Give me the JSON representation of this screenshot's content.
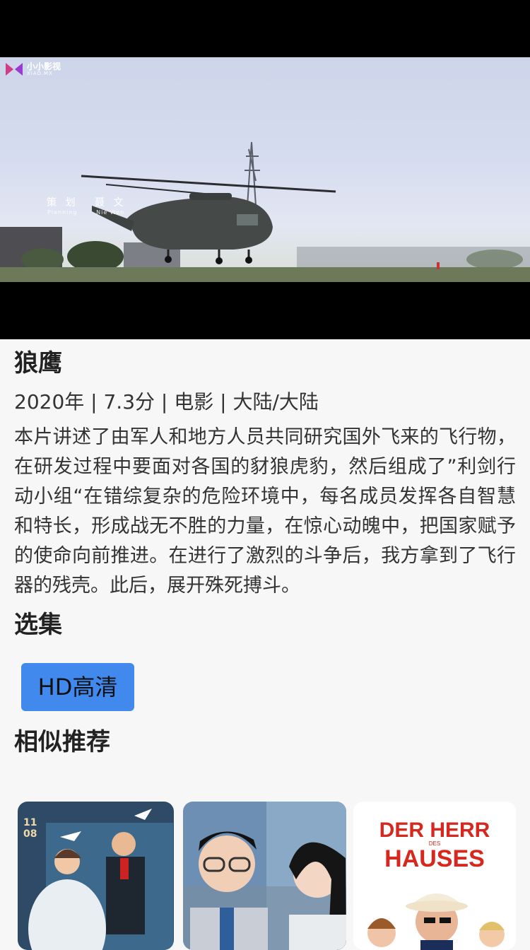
{
  "player": {
    "watermark_title": "小小影视",
    "watermark_sub": "XIAO.MX",
    "credit_1_cn": "策 划",
    "credit_1_en": "Planning",
    "credit_2_cn": "聂 文",
    "credit_2_en": "Nie Wen"
  },
  "movie": {
    "title": "狼鹰",
    "meta": "2020年 | 7.3分 | 电影 | 大陆/大陆",
    "description": "本片讲述了由军人和地方人员共同研究国外飞来的飞行物，在研发过程中要面对各国的豺狼虎豹，然后组成了”利剑行动小组“在错综复杂的危险环境中，每名成员发挥各自智慧和特长，形成战无不胜的力量，在惊心动魄中，把国家赋予的使命向前推进。在进行了激烈的斗争后，我方拿到了飞行器的残壳。此后，展开殊死搏斗。"
  },
  "episodes": {
    "section_title": "选集",
    "items": [
      "HD高清"
    ]
  },
  "recommend": {
    "section_title": "相似推荐",
    "posters": [
      {
        "date_text": "11\n08",
        "icon": "wedding-poster"
      },
      {
        "icon": "portrait-poster"
      },
      {
        "line1": "DER HERR",
        "small": "DES",
        "line2": "HAUSES",
        "icon": "comedy-poster"
      }
    ]
  },
  "colors": {
    "accent": "#4189ec",
    "background": "#f7f7f7"
  }
}
